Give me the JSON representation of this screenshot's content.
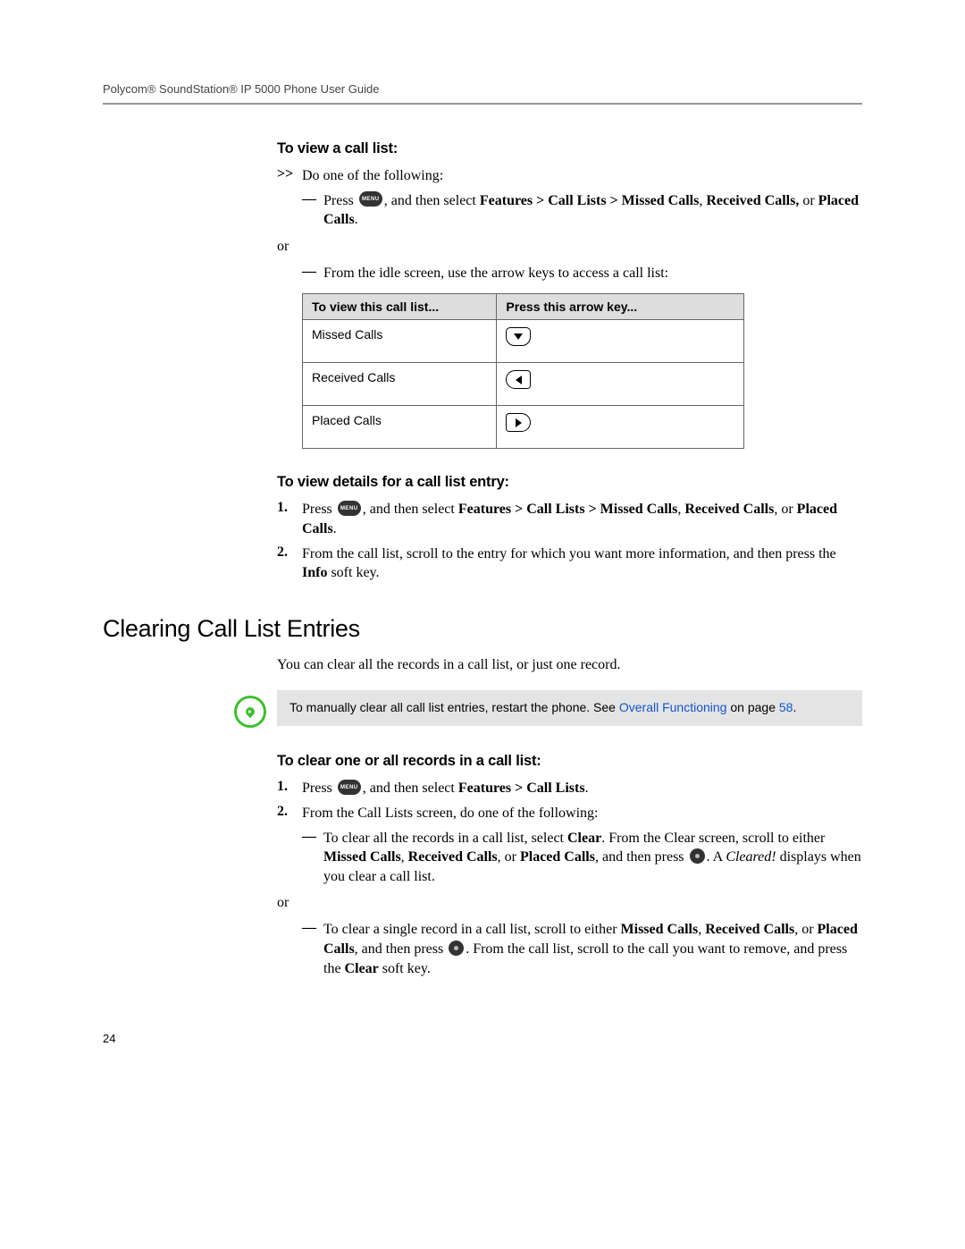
{
  "header": "Polycom® SoundStation® IP 5000 Phone User Guide",
  "s1": {
    "heading": "To view a call list:",
    "marker": ">>",
    "lead": "Do one of the following:",
    "opt1_a": "Press ",
    "menu_label": "MENU",
    "opt1_b": ", and then select ",
    "opt1_bold1": "Features > Call Lists > Missed Calls",
    "opt1_c": ", ",
    "opt1_bold2": "Received Calls,",
    "opt1_d": " or ",
    "opt1_bold3": "Placed Calls",
    "opt1_e": ".",
    "or": "or",
    "opt2": "From the idle screen, use the arrow keys to access a call list:"
  },
  "table": {
    "h1": "To view this call list...",
    "h2": "Press this arrow key...",
    "r1": "Missed Calls",
    "r2": "Received Calls",
    "r3": "Placed Calls"
  },
  "s2": {
    "heading": "To view details for a call list entry:",
    "n1": "1.",
    "n1_a": "Press ",
    "n1_b": ", and then select ",
    "n1_bold1": "Features > Call Lists > Missed Calls",
    "n1_c": ", ",
    "n1_bold2": "Received Calls",
    "n1_d": ", or ",
    "n1_bold3": "Placed Calls",
    "n1_e": ".",
    "n2": "2.",
    "n2_a": "From the call list, scroll to the entry for which you want more information, and then press the ",
    "n2_bold": "Info",
    "n2_b": " soft key."
  },
  "section_heading": "Clearing Call List Entries",
  "intro": "You can clear all the records in a call list, or just one record.",
  "note": {
    "a": "To manually clear all call list entries, restart the phone. See ",
    "link1": "Overall Functioning",
    "b": " on page ",
    "link2": "58",
    "c": "."
  },
  "s3": {
    "heading": "To clear one or all records in a call list:",
    "n1": "1.",
    "n1_a": "Press ",
    "n1_b": ", and then select ",
    "n1_bold": "Features > Call Lists",
    "n1_c": ".",
    "n2": "2.",
    "n2_text": "From the Call Lists screen, do one of the following:",
    "opt1_a": "To clear all the records in a call list, select ",
    "opt1_bold1": "Clear",
    "opt1_b": ". From the Clear screen, scroll to either ",
    "opt1_bold2": "Missed Calls",
    "opt1_c": ", ",
    "opt1_bold3": "Received Calls",
    "opt1_d": ", or ",
    "opt1_bold4": "Placed Calls",
    "opt1_e": ", and then press ",
    "opt1_f": ". A ",
    "opt1_italic": "Cleared!",
    "opt1_g": " displays when you clear a call list.",
    "or": "or",
    "opt2_a": "To clear a single record in a call list, scroll to either ",
    "opt2_bold1": "Missed Calls",
    "opt2_b": ", ",
    "opt2_bold2": "Received Calls",
    "opt2_c": ", or ",
    "opt2_bold3": "Placed Calls",
    "opt2_d": ", and then press ",
    "opt2_e": ". From the call list, scroll to the call you want to remove, and press the ",
    "opt2_bold4": "Clear",
    "opt2_f": " soft key."
  },
  "page_number": "24",
  "dash": "—"
}
